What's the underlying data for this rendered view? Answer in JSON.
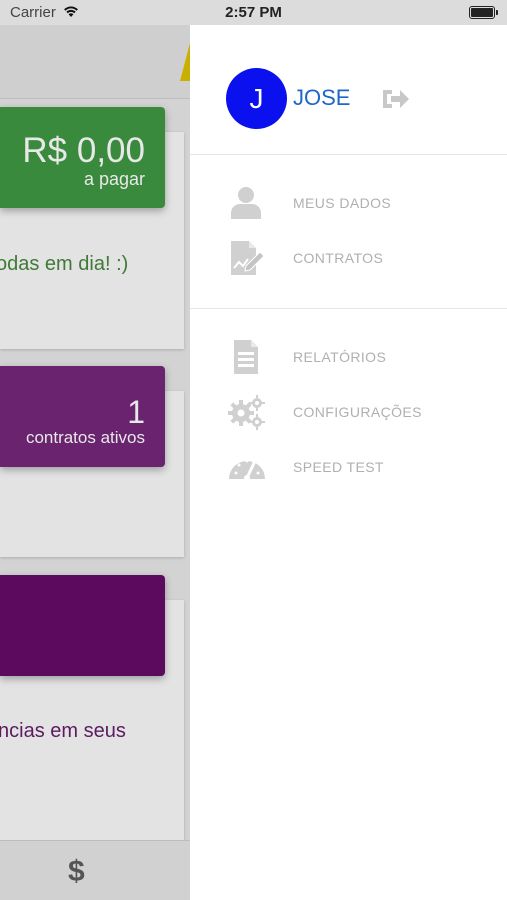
{
  "status_bar": {
    "carrier": "Carrier",
    "time": "2:57 PM"
  },
  "background_app": {
    "balance_tile": {
      "amount": "R$ 0,00",
      "caption": "a pagar",
      "color": "#3a8a3e"
    },
    "status_message": "odas em dia! :)",
    "contracts_tile": {
      "count": "1",
      "caption": "contratos ativos",
      "color": "#6a236f"
    },
    "third_tile": {
      "color": "#5b0a5e"
    },
    "notice_fragment": "ncias em seus",
    "bottom_bar": {
      "icon": "dollar-icon",
      "glyph": "$"
    }
  },
  "drawer": {
    "user": {
      "initial": "J",
      "name": "JOSE",
      "avatar_color": "#0a11ee"
    },
    "logout_icon": "logout-icon",
    "menu_group_1": [
      {
        "id": "meus-dados",
        "label": "MEUS DADOS",
        "icon": "user-icon"
      },
      {
        "id": "contratos",
        "label": "CONTRATOS",
        "icon": "contract-sign-icon"
      }
    ],
    "menu_group_2": [
      {
        "id": "relatorios",
        "label": "RELATÓRIOS",
        "icon": "report-icon"
      },
      {
        "id": "configuracoes",
        "label": "CONFIGURAÇÕES",
        "icon": "gears-icon"
      },
      {
        "id": "speed-test",
        "label": "SPEED TEST",
        "icon": "speedometer-icon"
      }
    ]
  }
}
